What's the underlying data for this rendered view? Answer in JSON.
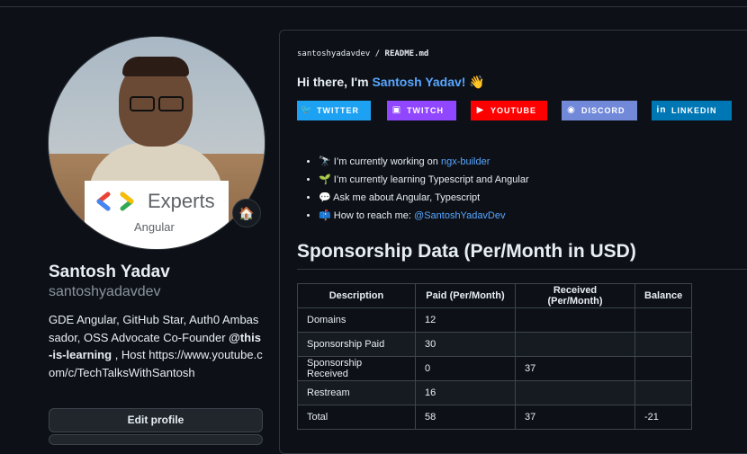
{
  "profile": {
    "full_name": "Santosh Yadav",
    "username": "santoshyadavdev",
    "bio_text": "GDE Angular, GitHub Star, Auth0 Ambassador, OSS Advocate Co-Founder ",
    "bio_org": "@this-is-learning",
    "bio_rest": " , Host https://www.youtube.com/c/TechTalksWithSantosh",
    "edit_button": "Edit profile",
    "status_emoji": "🏠",
    "badge_title": "Experts",
    "badge_subtitle": "Angular"
  },
  "readme": {
    "path_owner": "santoshyadavdev",
    "path_sep": " / ",
    "path_file": "README.md",
    "greeting_prefix": "Hi there, I'm ",
    "greeting_name": "Santosh Yadav!",
    "greeting_emoji": "👋",
    "socials": [
      {
        "label": "TWITTER",
        "icon": "twitter-icon",
        "color": "#1da1f2"
      },
      {
        "label": "TWITCH",
        "icon": "twitch-icon",
        "color": "#9146ff"
      },
      {
        "label": "YOUTUBE",
        "icon": "youtube-icon",
        "color": "#ff0000"
      },
      {
        "label": "DISCORD",
        "icon": "discord-icon",
        "color": "#7289da"
      },
      {
        "label": "LINKEDIN",
        "icon": "linkedin-icon",
        "color": "#0077b5"
      }
    ],
    "facts": [
      {
        "emoji": "🔭",
        "text": "I’m currently working on ",
        "link": "ngx-builder"
      },
      {
        "emoji": "🌱",
        "text": "I’m currently learning Typescript and Angular",
        "link": ""
      },
      {
        "emoji": "💬",
        "text": "Ask me about Angular, Typescript",
        "link": ""
      },
      {
        "emoji": "📫",
        "text": "How to reach me: ",
        "link": "@SantoshYadavDev"
      }
    ],
    "sponsorship": {
      "title": "Sponsorship Data (Per/Month in USD)",
      "headers": [
        "Description",
        "Paid (Per/Month)",
        "Received (Per/Month)",
        "Balance"
      ],
      "rows": [
        [
          "Domains",
          "12",
          "",
          ""
        ],
        [
          "Sponsorship Paid",
          "30",
          "",
          ""
        ],
        [
          "Sponsorship Received",
          "0",
          "37",
          ""
        ],
        [
          "Restream",
          "16",
          "",
          ""
        ],
        [
          "Total",
          "58",
          "37",
          "-21"
        ]
      ]
    }
  },
  "colors": {
    "accent_link": "#58a6ff",
    "background": "#0d1117"
  }
}
